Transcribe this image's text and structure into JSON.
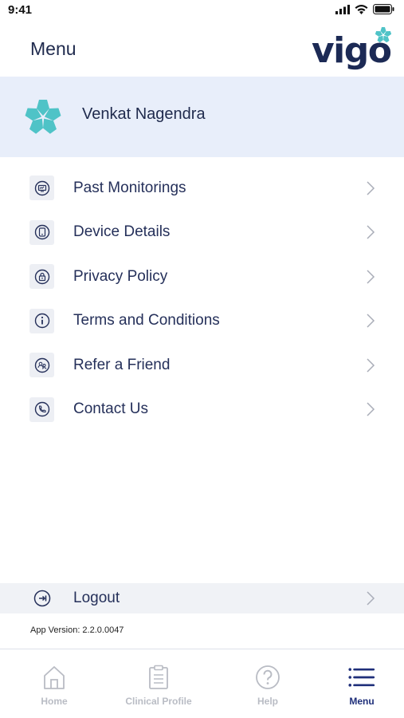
{
  "status_bar": {
    "time": "9:41",
    "icons": [
      "signal-icon",
      "wifi-icon",
      "battery-icon"
    ]
  },
  "header": {
    "title": "Menu",
    "logo_text": "vigo"
  },
  "profile": {
    "name": "Venkat Nagendra"
  },
  "menu": {
    "items": [
      {
        "label": "Past Monitorings",
        "icon": "monitor-icon"
      },
      {
        "label": "Device Details",
        "icon": "device-icon"
      },
      {
        "label": "Privacy Policy",
        "icon": "lock-icon"
      },
      {
        "label": "Terms and Conditions",
        "icon": "info-icon"
      },
      {
        "label": "Refer a Friend",
        "icon": "refer-icon"
      },
      {
        "label": "Contact Us",
        "icon": "phone-icon"
      }
    ]
  },
  "logout": {
    "label": "Logout",
    "icon": "logout-icon"
  },
  "app_version": "App Version: 2.2.0.0047",
  "tab_bar": {
    "tabs": [
      {
        "label": "Home",
        "icon": "home-icon",
        "active": false
      },
      {
        "label": "Clinical Profile",
        "icon": "clipboard-icon",
        "active": false
      },
      {
        "label": "Help",
        "icon": "help-icon",
        "active": false
      },
      {
        "label": "Menu",
        "icon": "menu-icon",
        "active": true
      }
    ]
  },
  "colors": {
    "brand_navy": "#1c2a55",
    "brand_teal": "#4fc3c7",
    "profile_bg": "#e8eefa",
    "active_tab": "#1f2f7a",
    "inactive_tab": "#b9bcc4"
  }
}
